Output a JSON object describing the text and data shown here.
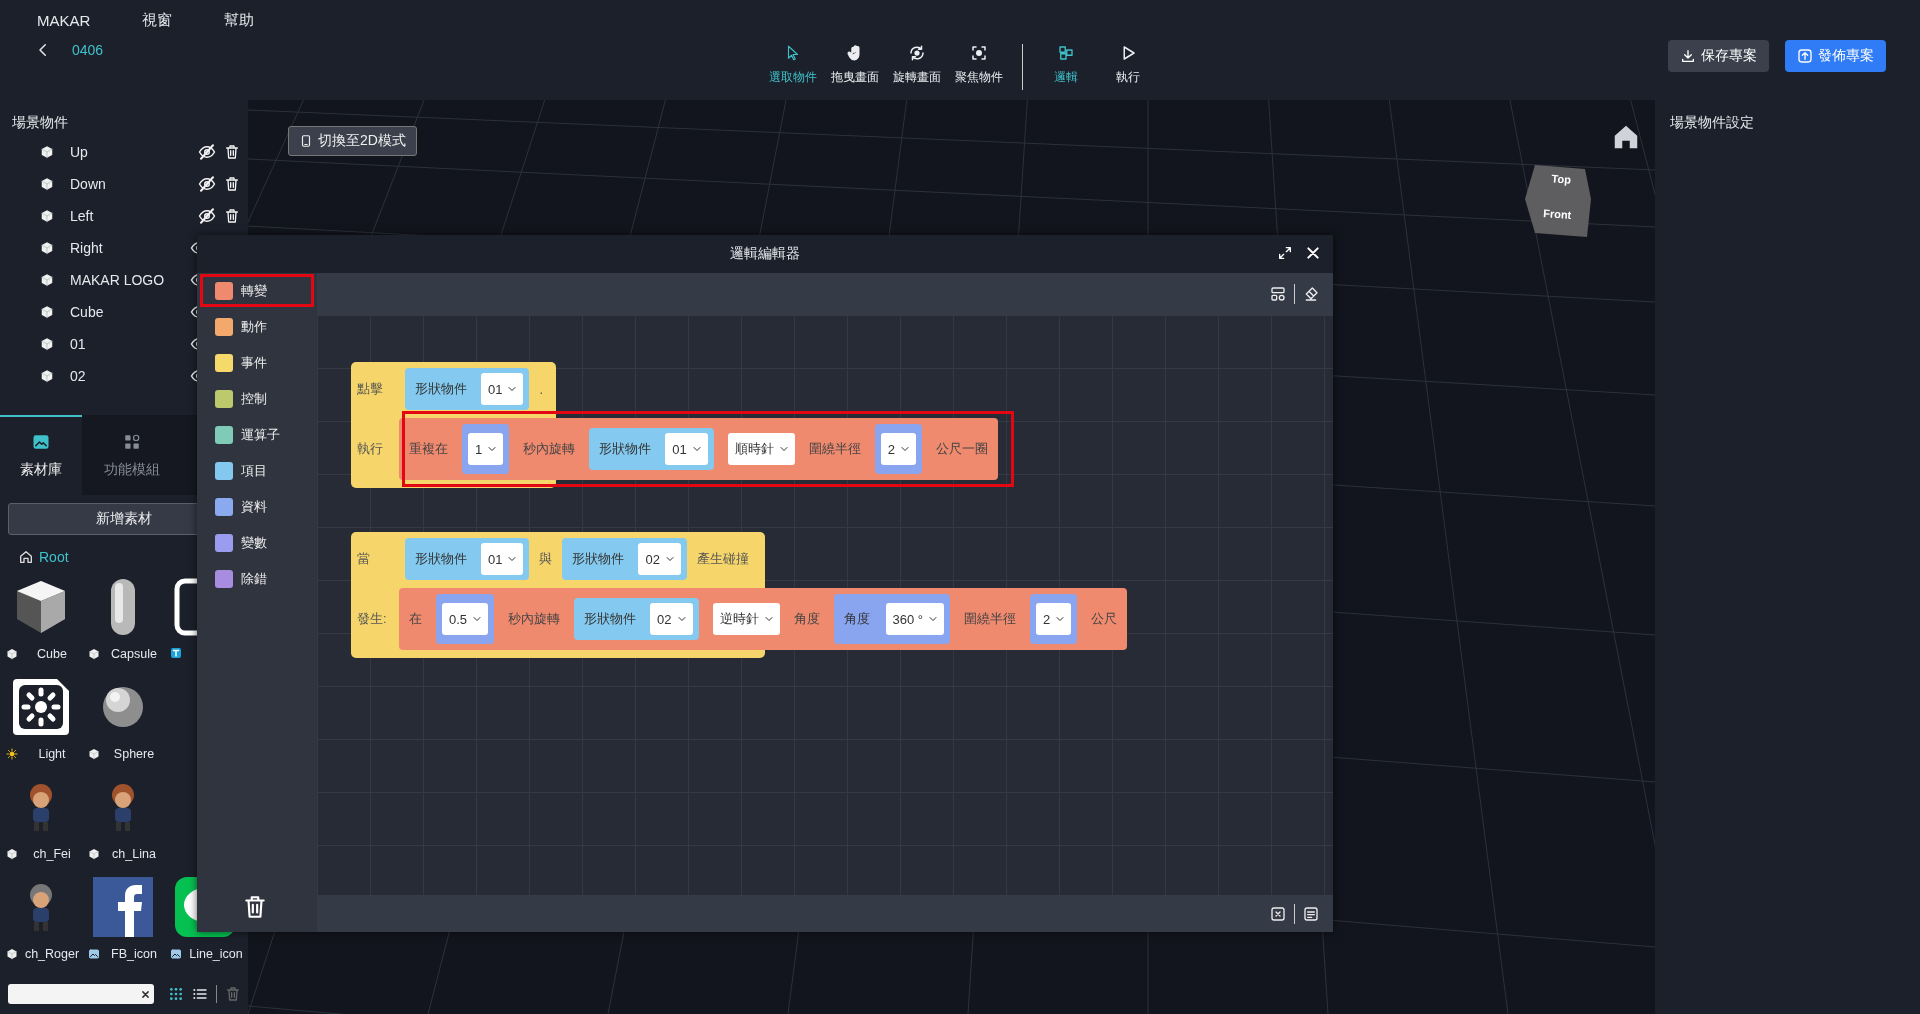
{
  "menu": [
    "MAKAR",
    "視窗",
    "幫助"
  ],
  "project": {
    "name": "0406"
  },
  "tools": [
    {
      "kind": "select",
      "label": "選取物件",
      "active": true
    },
    {
      "kind": "pan",
      "label": "拖曳畫面",
      "active": false
    },
    {
      "kind": "rotate",
      "label": "旋轉畫面",
      "active": false
    },
    {
      "kind": "focus",
      "label": "聚焦物件",
      "active": false
    },
    {
      "kind": "logic",
      "label": "邏輯",
      "active": true
    },
    {
      "kind": "run",
      "label": "執行",
      "active": false
    }
  ],
  "actions": [
    {
      "kind": "save",
      "label": "保存專案"
    },
    {
      "kind": "publish",
      "label": "發佈專案"
    }
  ],
  "scene_objects": {
    "title": "場景物件",
    "items": [
      {
        "name": "Up",
        "hidden": true
      },
      {
        "name": "Down",
        "hidden": true
      },
      {
        "name": "Left",
        "hidden": true
      },
      {
        "name": "Right",
        "hidden": false
      },
      {
        "name": "MAKAR LOGO",
        "hidden": false
      },
      {
        "name": "Cube",
        "hidden": false
      },
      {
        "name": "01",
        "hidden": false
      },
      {
        "name": "02",
        "hidden": false
      }
    ]
  },
  "asset_tabs": [
    {
      "kind": "library",
      "label": "素材庫",
      "selected": true
    },
    {
      "kind": "modules",
      "label": "功能模組",
      "selected": false
    }
  ],
  "add_asset": "新增素材",
  "root": "Root",
  "assets": [
    [
      {
        "kind": "cube",
        "name": "Cube"
      },
      {
        "kind": "capsule",
        "name": "Capsule"
      },
      {
        "kind": "text"
      }
    ],
    [
      {
        "kind": "light",
        "name": "Light"
      },
      {
        "kind": "sphere",
        "name": "Sphere"
      }
    ],
    [
      {
        "kind": "figure",
        "name": "ch_Fei"
      },
      {
        "kind": "figure",
        "name": "ch_Lina"
      }
    ],
    [
      {
        "kind": "figure",
        "name": "ch_Roger"
      },
      {
        "kind": "fb",
        "name": "FB_icon"
      },
      {
        "kind": "line",
        "name": "Line_icon"
      }
    ]
  ],
  "viewport": {
    "mode_button": "切換至2D模式",
    "cube_faces": [
      "Top",
      "Front"
    ]
  },
  "settings_title": "場景物件設定",
  "editor": {
    "title": "邏輯編輯器",
    "categories": [
      {
        "label": "轉變",
        "color": "#f08a6f",
        "selected": true
      },
      {
        "label": "動作",
        "color": "#f3a96b",
        "selected": false
      },
      {
        "label": "事件",
        "color": "#f6d96b",
        "selected": false
      },
      {
        "label": "控制",
        "color": "#bcc96c",
        "selected": false
      },
      {
        "label": "運算子",
        "color": "#7fcbb8",
        "selected": false
      },
      {
        "label": "項目",
        "color": "#83c8ee",
        "selected": false
      },
      {
        "label": "資料",
        "color": "#8aa9ee",
        "selected": false
      },
      {
        "label": "變數",
        "color": "#9b9cf0",
        "selected": false
      },
      {
        "label": "除錯",
        "color": "#a78ce0",
        "selected": false
      }
    ],
    "blocks": [
      {
        "rows": [
          {
            "label": "點擊",
            "parts": [
              {
                "kind": "shape",
                "label": "形狀物件",
                "value": "01"
              },
              {
                "kind": "text",
                "text": "."
              }
            ]
          },
          {
            "label": "執行",
            "highlighted": true,
            "statement": [
              {
                "kind": "text",
                "text": "重複在"
              },
              {
                "kind": "number",
                "value": "1"
              },
              {
                "kind": "text",
                "text": "秒內旋轉"
              },
              {
                "kind": "shape",
                "label": "形狀物件",
                "value": "01"
              },
              {
                "kind": "dropdown",
                "value": "順時針"
              },
              {
                "kind": "text",
                "text": "圍繞半徑"
              },
              {
                "kind": "number",
                "value": "2"
              },
              {
                "kind": "text",
                "text": "公尺一圈"
              }
            ]
          }
        ]
      },
      {
        "rows": [
          {
            "label": "當",
            "parts": [
              {
                "kind": "shape",
                "label": "形狀物件",
                "value": "01"
              },
              {
                "kind": "text",
                "text": "與"
              },
              {
                "kind": "shape",
                "label": "形狀物件",
                "value": "02"
              },
              {
                "kind": "text",
                "text": "產生碰撞"
              }
            ]
          },
          {
            "label": "發生:",
            "highlighted": false,
            "statement": [
              {
                "kind": "text",
                "text": "在"
              },
              {
                "kind": "number",
                "value": "0.5"
              },
              {
                "kind": "text",
                "text": "秒內旋轉"
              },
              {
                "kind": "shape",
                "label": "形狀物件",
                "value": "02"
              },
              {
                "kind": "dropdown",
                "value": "逆時針"
              },
              {
                "kind": "text",
                "text": "角度"
              },
              {
                "kind": "angle",
                "label": "角度",
                "value": "360 °"
              },
              {
                "kind": "text",
                "text": "圍繞半徑"
              },
              {
                "kind": "number",
                "value": "2"
              },
              {
                "kind": "text",
                "text": "公尺"
              }
            ]
          }
        ]
      }
    ]
  }
}
